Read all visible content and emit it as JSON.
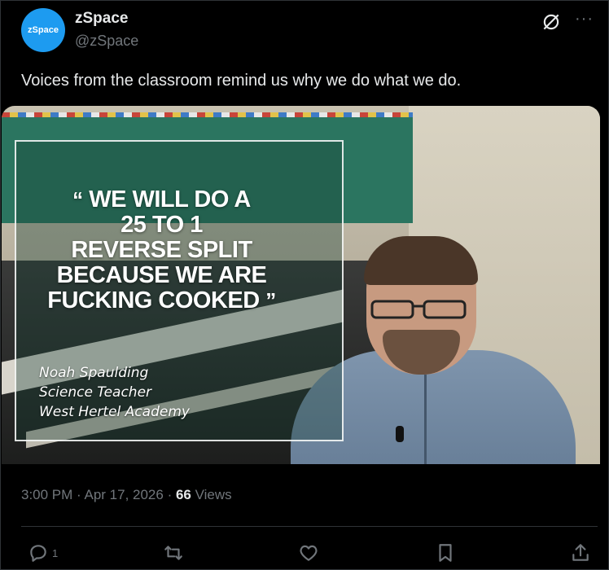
{
  "author": {
    "avatar_text": "zSpace",
    "name": "zSpace",
    "handle": "@zSpace"
  },
  "icons": {
    "grok": "grok-icon",
    "more": "more-icon",
    "reply": "reply-icon",
    "retweet": "retweet-icon",
    "like": "heart-icon",
    "bookmark": "bookmark-icon",
    "share": "share-icon"
  },
  "tweet": {
    "text": "Voices from the classroom remind us why we do what we do."
  },
  "media": {
    "quote_open": "“",
    "quote_lines": [
      "WE WILL DO A",
      "25 TO 1",
      "REVERSE SPLIT",
      "BECAUSE WE ARE",
      "FUCKING COOKED"
    ],
    "quote_close": "”",
    "attribution": [
      "Noah Spaulding",
      "Science Teacher",
      "West Hertel Academy"
    ]
  },
  "meta": {
    "time": "3:00 PM",
    "sep1": " · ",
    "date": "Apr 17, 2026",
    "sep2": " · ",
    "views_count": "66",
    "views_label": "Views"
  },
  "actions": {
    "reply_count": "1"
  },
  "colors": {
    "background": "#000000",
    "text": "#e7e9ea",
    "muted": "#71767b",
    "avatar": "#1d9bf0"
  }
}
